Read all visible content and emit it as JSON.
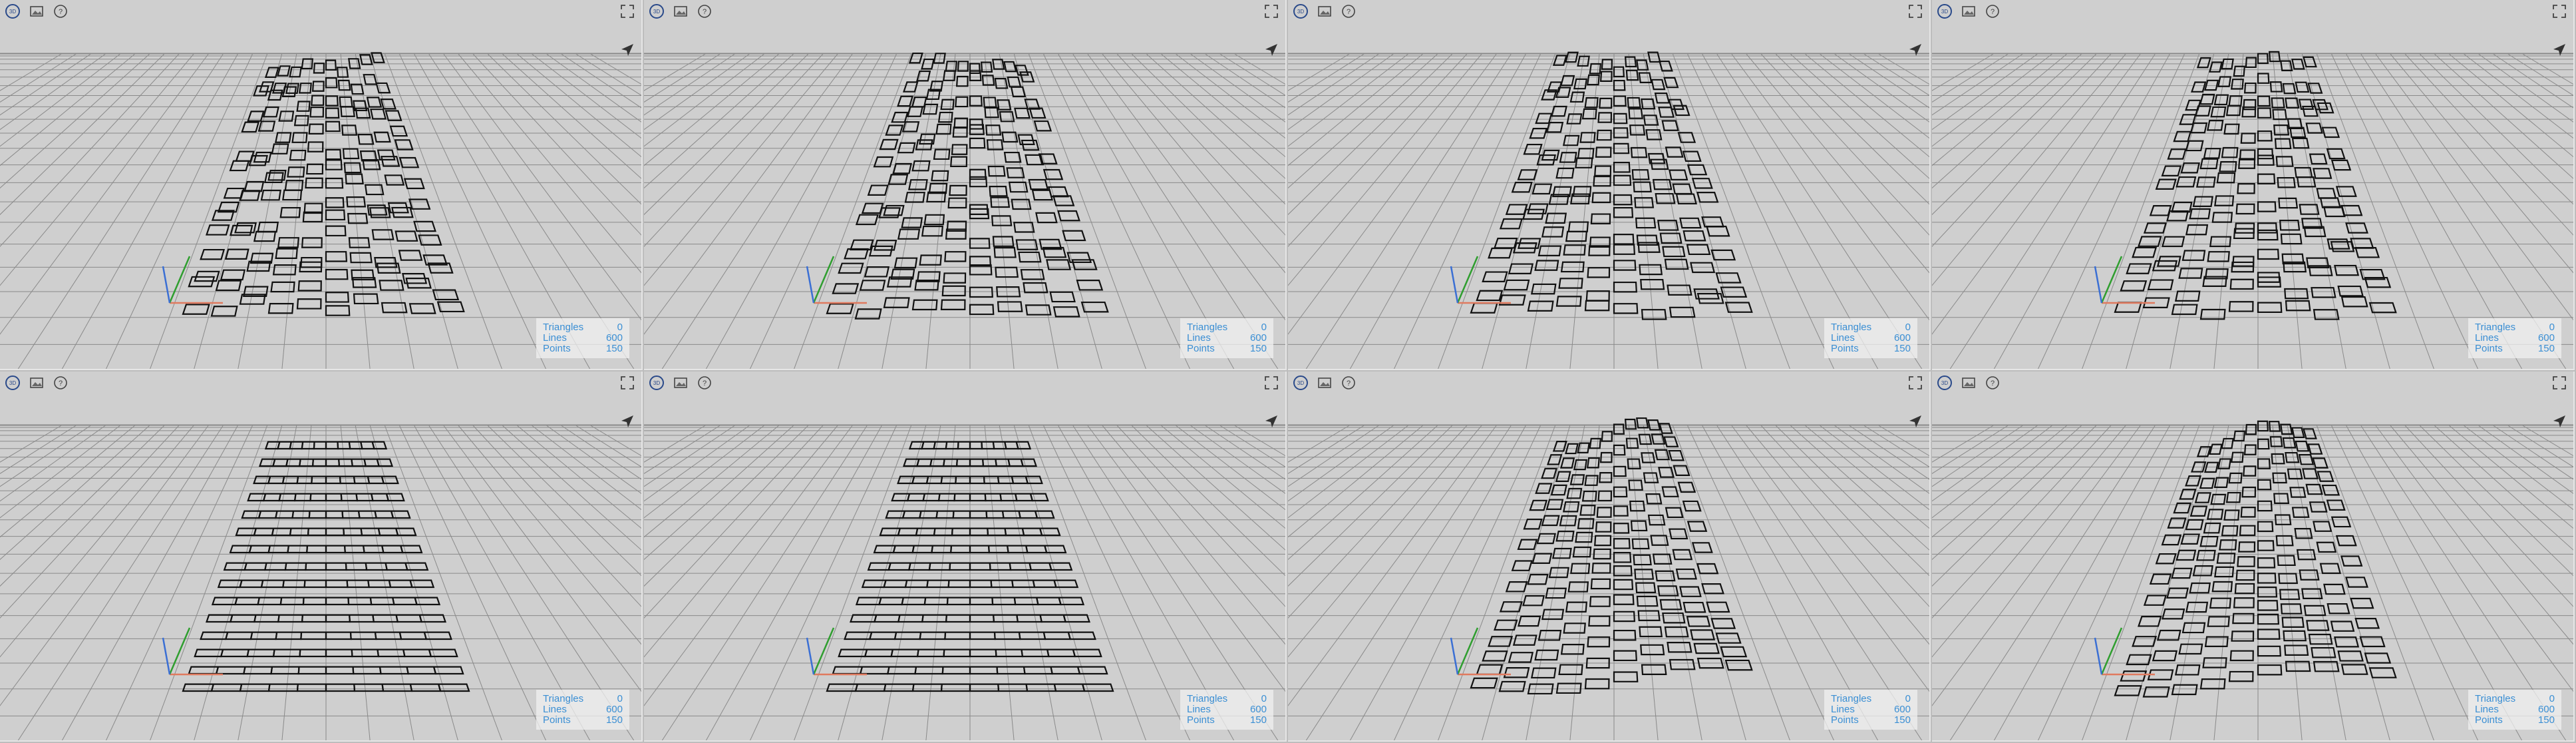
{
  "toolbar": {
    "view3d_icon": "3d-view-icon",
    "screenshot_icon": "image-icon",
    "help_icon": "help-icon",
    "fullscreen_icon": "expand-icon",
    "nav_icon": "navigation-arrow-icon"
  },
  "colors": {
    "viewport_bg": "#cfcfcf",
    "grid_line": "#8a8a8a",
    "mesh_line": "#111111",
    "stats_text": "#3b8fd4",
    "axis_x": "#e07a5f",
    "axis_y": "#2f9e2f",
    "axis_z": "#3b6fd4"
  },
  "stats_labels": {
    "triangles": "Triangles",
    "lines": "Lines",
    "points": "Points"
  },
  "viewports": [
    {
      "id": "v1",
      "variant": "blocks",
      "stats": {
        "triangles": "0",
        "lines": "600",
        "points": "150"
      }
    },
    {
      "id": "v2",
      "variant": "blocks",
      "stats": {
        "triangles": "0",
        "lines": "600",
        "points": "150"
      }
    },
    {
      "id": "v3",
      "variant": "blocks",
      "stats": {
        "triangles": "0",
        "lines": "600",
        "points": "150"
      }
    },
    {
      "id": "v4",
      "variant": "blocks",
      "stats": {
        "triangles": "0",
        "lines": "600",
        "points": "150"
      }
    },
    {
      "id": "v5",
      "variant": "strips",
      "stats": {
        "triangles": "0",
        "lines": "600",
        "points": "150"
      }
    },
    {
      "id": "v6",
      "variant": "strips",
      "stats": {
        "triangles": "0",
        "lines": "600",
        "points": "150"
      }
    },
    {
      "id": "v7",
      "variant": "wave",
      "stats": {
        "triangles": "0",
        "lines": "600",
        "points": "150"
      }
    },
    {
      "id": "v8",
      "variant": "wave",
      "stats": {
        "triangles": "0",
        "lines": "600",
        "points": "150"
      }
    }
  ]
}
